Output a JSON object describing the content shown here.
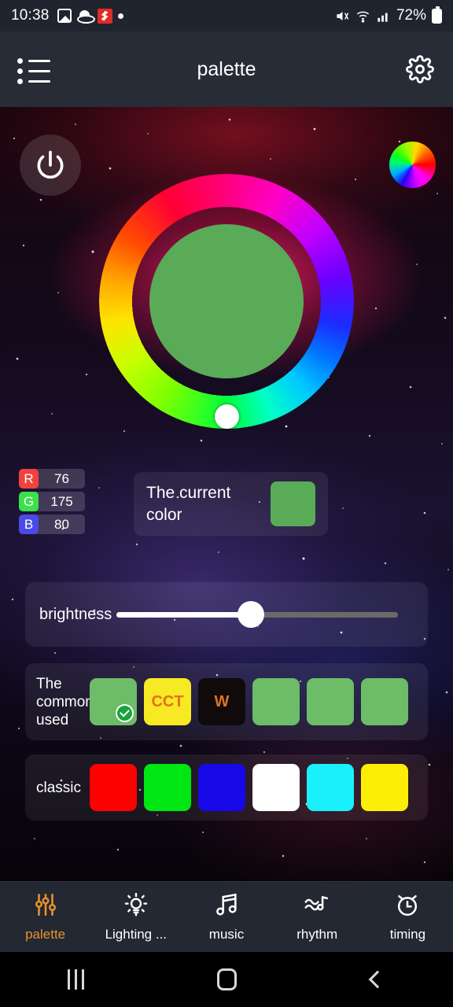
{
  "status_bar": {
    "time": "10:38",
    "battery_percent": "72%",
    "left_icons": [
      "gallery-icon",
      "saturn-icon",
      "red-app-icon",
      "dot-icon"
    ],
    "right_icons": [
      "mute-icon",
      "wifi-icon",
      "signal-icon",
      "battery-icon"
    ]
  },
  "app_bar": {
    "title": "palette",
    "menu_icon": "list-menu-icon",
    "settings_icon": "gear-icon"
  },
  "controls": {
    "power_icon": "power-icon",
    "color_wheel_icon": "color-wheel-icon"
  },
  "color_ring": {
    "selected_color": "#5aab58",
    "thumb_position_deg": 180
  },
  "rgb": {
    "rows": [
      {
        "key": "R",
        "value": "76",
        "key_color": "#f0423c"
      },
      {
        "key": "G",
        "value": "175",
        "key_color": "#3ce04a"
      },
      {
        "key": "B",
        "value": "80",
        "key_color": "#4a4ae8"
      }
    ]
  },
  "current_color": {
    "label": "The current color",
    "swatch": "#5aab58"
  },
  "brightness": {
    "label": "brightness",
    "value_percent": 50
  },
  "commonly_used": {
    "label": "The commonly used",
    "swatches": [
      {
        "name": "green-preset",
        "color": "#6cbc68",
        "text": "",
        "text_color": "",
        "selected": true
      },
      {
        "name": "cct-preset",
        "color": "#f7e923",
        "text": "CCT",
        "text_color": "#e2711d",
        "selected": false
      },
      {
        "name": "white-preset",
        "color": "#100a0a",
        "text": "W",
        "text_color": "#e2711d",
        "selected": false
      },
      {
        "name": "green-preset-2",
        "color": "#6cbc68",
        "text": "",
        "text_color": "",
        "selected": false
      },
      {
        "name": "green-preset-3",
        "color": "#6cbc68",
        "text": "",
        "text_color": "",
        "selected": false
      },
      {
        "name": "green-preset-4",
        "color": "#6cbc68",
        "text": "",
        "text_color": "",
        "selected": false
      }
    ]
  },
  "classic": {
    "label": "classic",
    "swatches": [
      {
        "name": "red-swatch",
        "color": "#fd0000"
      },
      {
        "name": "green-swatch",
        "color": "#00e612"
      },
      {
        "name": "blue-swatch",
        "color": "#1708e8"
      },
      {
        "name": "white-swatch",
        "color": "#ffffff"
      },
      {
        "name": "cyan-swatch",
        "color": "#19f0fb"
      },
      {
        "name": "yellow-swatch",
        "color": "#fcee07"
      }
    ]
  },
  "tabs": [
    {
      "name": "tab-palette",
      "label": "palette",
      "icon": "sliders-icon",
      "active": true
    },
    {
      "name": "tab-lighting",
      "label": "Lighting ...",
      "icon": "bulb-icon",
      "active": false
    },
    {
      "name": "tab-music",
      "label": "music",
      "icon": "music-note-icon",
      "active": false
    },
    {
      "name": "tab-rhythm",
      "label": "rhythm",
      "icon": "rhythm-wave-icon",
      "active": false
    },
    {
      "name": "tab-timing",
      "label": "timing",
      "icon": "alarm-clock-icon",
      "active": false
    }
  ],
  "nav_bar": {
    "recents_icon": "recents-icon",
    "home_icon": "home-icon",
    "back_icon": "back-icon"
  },
  "theme": {
    "accent": "#e8922c",
    "appbar_bg": "#272c37",
    "statusbar_bg": "#1f242e",
    "tabbar_bg": "#232832"
  }
}
